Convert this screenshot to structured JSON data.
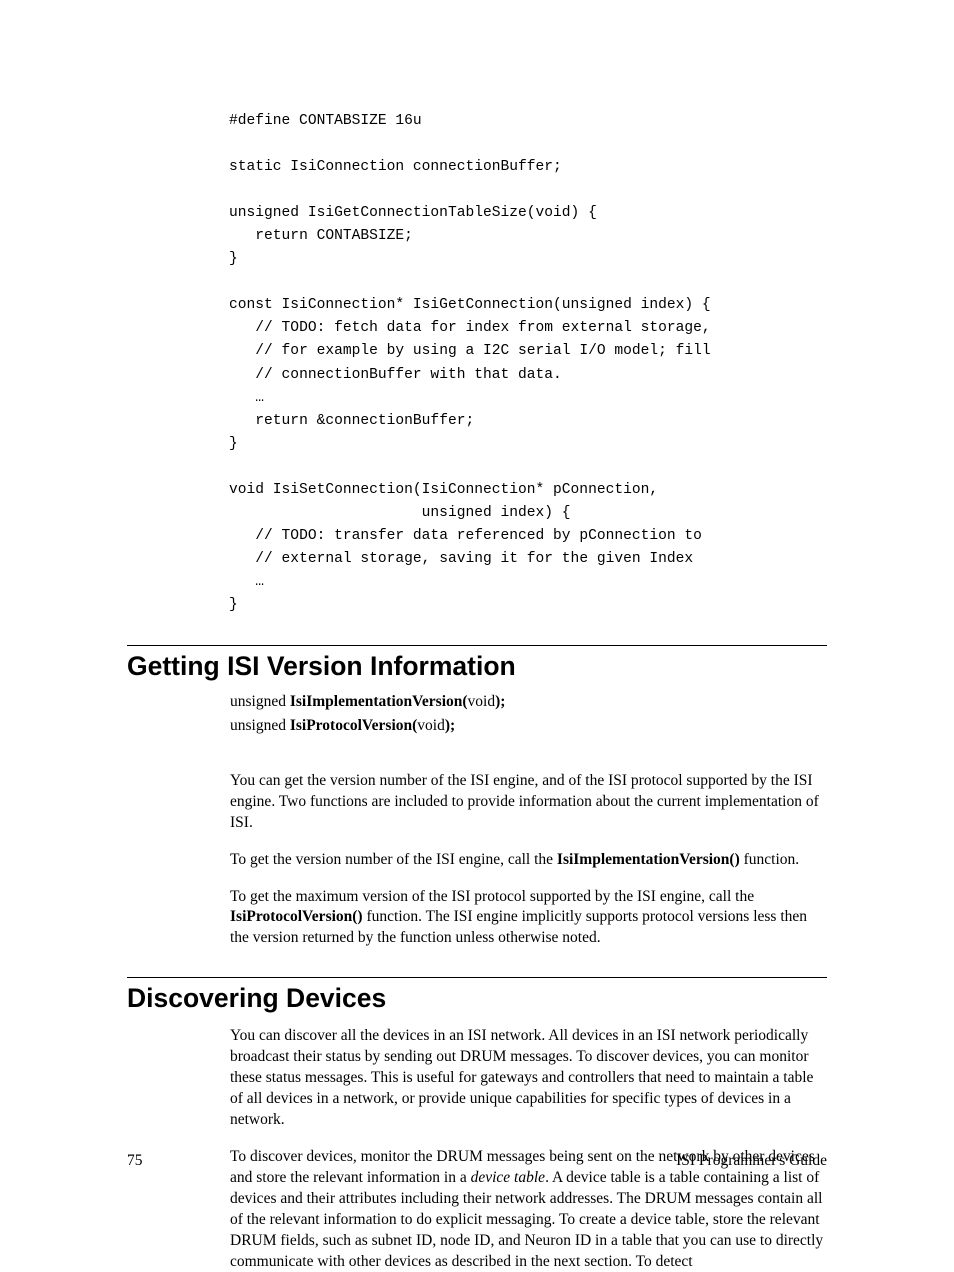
{
  "code_block": "#define CONTABSIZE 16u\n\nstatic IsiConnection connectionBuffer;\n\nunsigned IsiGetConnectionTableSize(void) {\n   return CONTABSIZE;\n}\n\nconst IsiConnection* IsiGetConnection(unsigned index) {\n   // TODO: fetch data for index from external storage,\n   // for example by using a I2C serial I/O model; fill\n   // connectionBuffer with that data.\n   …\n   return &connectionBuffer;\n}\n\nvoid IsiSetConnection(IsiConnection* pConnection,\n                      unsigned index) {\n   // TODO: transfer data referenced by pConnection to\n   // external storage, saving it for the given Index\n   …\n}",
  "section1": {
    "heading": "Getting ISI Version Information",
    "sig1_prefix": "unsigned ",
    "sig1_bold": "IsiImplementationVersion(",
    "sig1_mid": "void",
    "sig1_bold2": ");",
    "sig2_prefix": "unsigned ",
    "sig2_bold": "IsiProtocolVersion(",
    "sig2_mid": "void",
    "sig2_bold2": ");",
    "p1": "You can get the version number of the ISI engine, and of the ISI protocol supported by the ISI engine.  Two functions are included to provide information about the current implementation of ISI.",
    "p2a": "To get the version number of the ISI engine, call the ",
    "p2b": "IsiImplementationVersion()",
    "p2c": " function.",
    "p3a": "To get the maximum version of the ISI protocol supported by the ISI engine, call the ",
    "p3b": "IsiProtocolVersion()",
    "p3c": " function.  The ISI engine implicitly supports protocol versions less then the version returned by the function unless otherwise noted."
  },
  "section2": {
    "heading": "Discovering Devices",
    "p1": "You can discover all the devices in an ISI network.  All devices in an ISI network periodically broadcast their status by sending out DRUM messages.  To discover devices, you can monitor these status messages.  This is useful for gateways and controllers that need to maintain a table of all devices in a network, or provide unique capabilities for specific types of devices in a network.",
    "p2a": "To discover devices, monitor the DRUM messages being sent on the network by other devices and store the relevant information in a ",
    "p2b": "device table",
    "p2c": ".  A device table is a table containing a list of devices and their attributes including their network addresses.  The DRUM messages contain all of the relevant information to do explicit messaging.  To create a device table, store the relevant DRUM fields, such as subnet ID, node ID, and Neuron ID in a table that you can use to directly communicate with other devices as described in the next section.  To detect"
  },
  "footer": {
    "page_no": "75",
    "guide": "ISI Programmer's Guide"
  }
}
